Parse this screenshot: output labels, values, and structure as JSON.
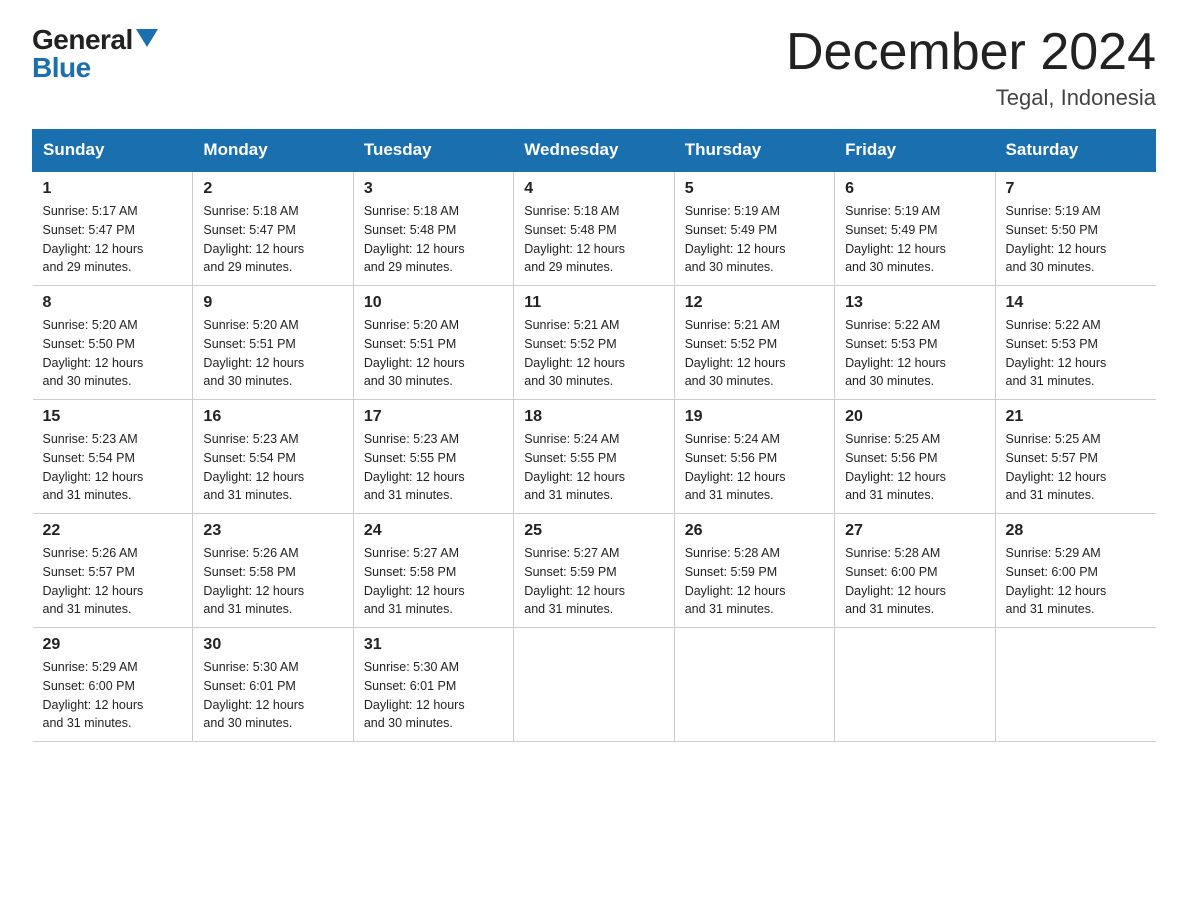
{
  "header": {
    "logo_general": "General",
    "logo_blue": "Blue",
    "month_title": "December 2024",
    "location": "Tegal, Indonesia"
  },
  "weekdays": [
    "Sunday",
    "Monday",
    "Tuesday",
    "Wednesday",
    "Thursday",
    "Friday",
    "Saturday"
  ],
  "weeks": [
    [
      {
        "day": "1",
        "sunrise": "5:17 AM",
        "sunset": "5:47 PM",
        "daylight": "12 hours and 29 minutes."
      },
      {
        "day": "2",
        "sunrise": "5:18 AM",
        "sunset": "5:47 PM",
        "daylight": "12 hours and 29 minutes."
      },
      {
        "day": "3",
        "sunrise": "5:18 AM",
        "sunset": "5:48 PM",
        "daylight": "12 hours and 29 minutes."
      },
      {
        "day": "4",
        "sunrise": "5:18 AM",
        "sunset": "5:48 PM",
        "daylight": "12 hours and 29 minutes."
      },
      {
        "day": "5",
        "sunrise": "5:19 AM",
        "sunset": "5:49 PM",
        "daylight": "12 hours and 30 minutes."
      },
      {
        "day": "6",
        "sunrise": "5:19 AM",
        "sunset": "5:49 PM",
        "daylight": "12 hours and 30 minutes."
      },
      {
        "day": "7",
        "sunrise": "5:19 AM",
        "sunset": "5:50 PM",
        "daylight": "12 hours and 30 minutes."
      }
    ],
    [
      {
        "day": "8",
        "sunrise": "5:20 AM",
        "sunset": "5:50 PM",
        "daylight": "12 hours and 30 minutes."
      },
      {
        "day": "9",
        "sunrise": "5:20 AM",
        "sunset": "5:51 PM",
        "daylight": "12 hours and 30 minutes."
      },
      {
        "day": "10",
        "sunrise": "5:20 AM",
        "sunset": "5:51 PM",
        "daylight": "12 hours and 30 minutes."
      },
      {
        "day": "11",
        "sunrise": "5:21 AM",
        "sunset": "5:52 PM",
        "daylight": "12 hours and 30 minutes."
      },
      {
        "day": "12",
        "sunrise": "5:21 AM",
        "sunset": "5:52 PM",
        "daylight": "12 hours and 30 minutes."
      },
      {
        "day": "13",
        "sunrise": "5:22 AM",
        "sunset": "5:53 PM",
        "daylight": "12 hours and 30 minutes."
      },
      {
        "day": "14",
        "sunrise": "5:22 AM",
        "sunset": "5:53 PM",
        "daylight": "12 hours and 31 minutes."
      }
    ],
    [
      {
        "day": "15",
        "sunrise": "5:23 AM",
        "sunset": "5:54 PM",
        "daylight": "12 hours and 31 minutes."
      },
      {
        "day": "16",
        "sunrise": "5:23 AM",
        "sunset": "5:54 PM",
        "daylight": "12 hours and 31 minutes."
      },
      {
        "day": "17",
        "sunrise": "5:23 AM",
        "sunset": "5:55 PM",
        "daylight": "12 hours and 31 minutes."
      },
      {
        "day": "18",
        "sunrise": "5:24 AM",
        "sunset": "5:55 PM",
        "daylight": "12 hours and 31 minutes."
      },
      {
        "day": "19",
        "sunrise": "5:24 AM",
        "sunset": "5:56 PM",
        "daylight": "12 hours and 31 minutes."
      },
      {
        "day": "20",
        "sunrise": "5:25 AM",
        "sunset": "5:56 PM",
        "daylight": "12 hours and 31 minutes."
      },
      {
        "day": "21",
        "sunrise": "5:25 AM",
        "sunset": "5:57 PM",
        "daylight": "12 hours and 31 minutes."
      }
    ],
    [
      {
        "day": "22",
        "sunrise": "5:26 AM",
        "sunset": "5:57 PM",
        "daylight": "12 hours and 31 minutes."
      },
      {
        "day": "23",
        "sunrise": "5:26 AM",
        "sunset": "5:58 PM",
        "daylight": "12 hours and 31 minutes."
      },
      {
        "day": "24",
        "sunrise": "5:27 AM",
        "sunset": "5:58 PM",
        "daylight": "12 hours and 31 minutes."
      },
      {
        "day": "25",
        "sunrise": "5:27 AM",
        "sunset": "5:59 PM",
        "daylight": "12 hours and 31 minutes."
      },
      {
        "day": "26",
        "sunrise": "5:28 AM",
        "sunset": "5:59 PM",
        "daylight": "12 hours and 31 minutes."
      },
      {
        "day": "27",
        "sunrise": "5:28 AM",
        "sunset": "6:00 PM",
        "daylight": "12 hours and 31 minutes."
      },
      {
        "day": "28",
        "sunrise": "5:29 AM",
        "sunset": "6:00 PM",
        "daylight": "12 hours and 31 minutes."
      }
    ],
    [
      {
        "day": "29",
        "sunrise": "5:29 AM",
        "sunset": "6:00 PM",
        "daylight": "12 hours and 31 minutes."
      },
      {
        "day": "30",
        "sunrise": "5:30 AM",
        "sunset": "6:01 PM",
        "daylight": "12 hours and 30 minutes."
      },
      {
        "day": "31",
        "sunrise": "5:30 AM",
        "sunset": "6:01 PM",
        "daylight": "12 hours and 30 minutes."
      },
      null,
      null,
      null,
      null
    ]
  ],
  "labels": {
    "sunrise": "Sunrise:",
    "sunset": "Sunset:",
    "daylight": "Daylight:"
  }
}
